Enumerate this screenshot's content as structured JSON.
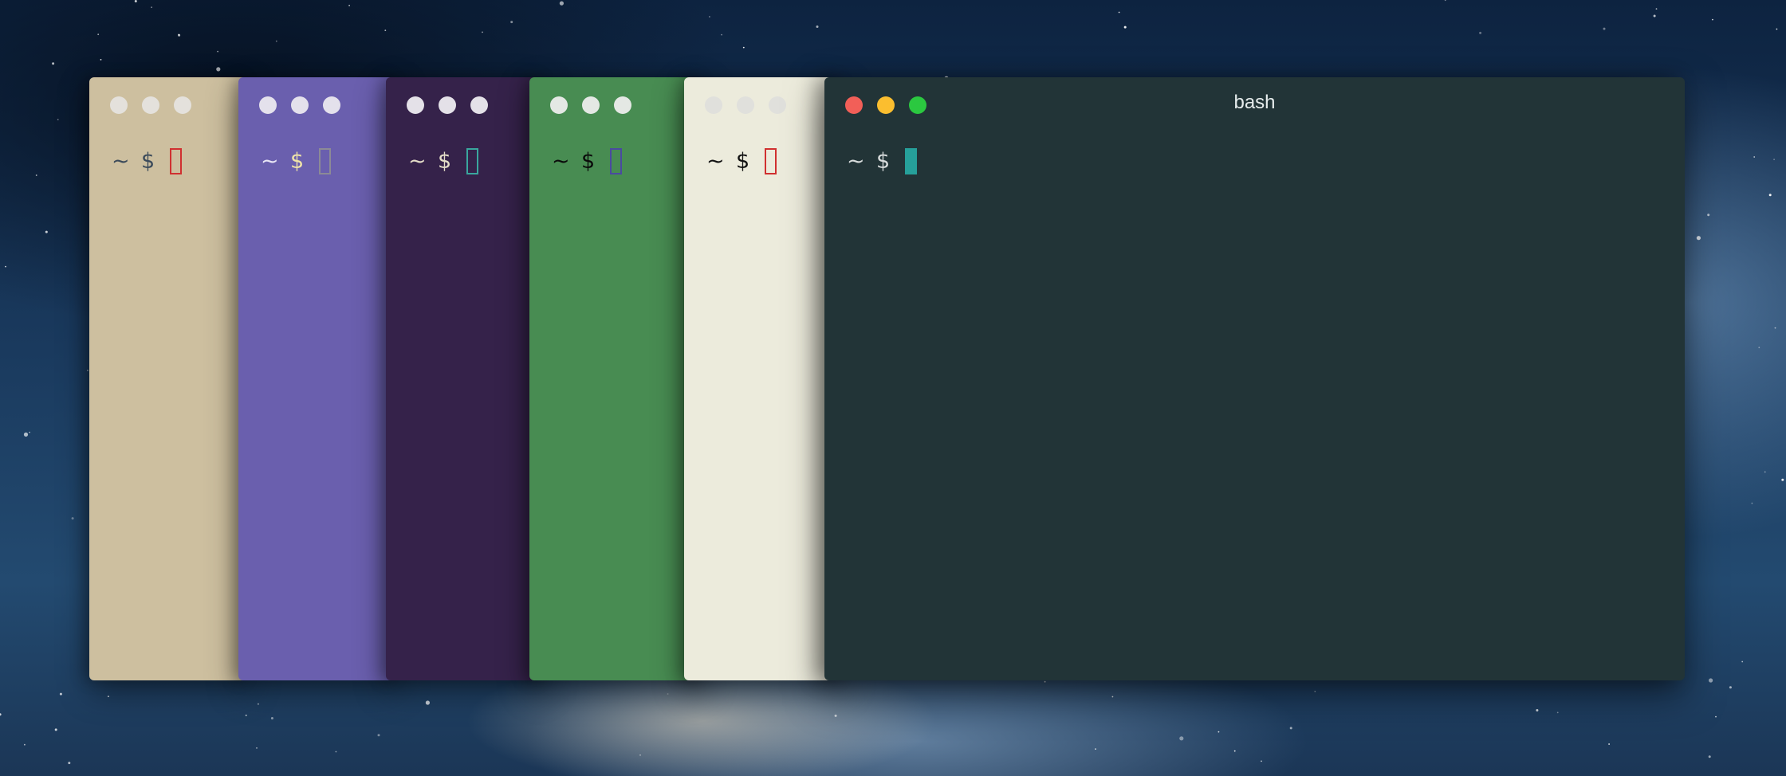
{
  "desktop": {
    "wallpaper": "space-galaxy-wallpaper"
  },
  "windows": [
    {
      "theme_bg": "#cdbf9f",
      "light_color": "#e4e1dc",
      "fg": "#3b4a5a",
      "dollar_color": "#3b4a5a",
      "cursor_color": "#d03030",
      "cursor_style": "outline",
      "prompt": {
        "tilde": "~",
        "dollar": "$"
      }
    },
    {
      "theme_bg": "#6a5fae",
      "light_color": "#e4e1ec",
      "fg": "#e9e6f5",
      "dollar_color": "#f0e4a8",
      "cursor_color": "#8c8a96",
      "cursor_style": "outline",
      "prompt": {
        "tilde": "~",
        "dollar": "$"
      }
    },
    {
      "theme_bg": "#35224a",
      "light_color": "#e4e1e8",
      "fg": "#e4ddc8",
      "dollar_color": "#e4ddc8",
      "cursor_color": "#3aa79e",
      "cursor_style": "outline",
      "prompt": {
        "tilde": "~",
        "dollar": "$"
      }
    },
    {
      "theme_bg": "#488c52",
      "light_color": "#e4e8e4",
      "fg": "#0a0a0a",
      "dollar_color": "#0a0a0a",
      "cursor_color": "#4a4aa0",
      "cursor_style": "outline",
      "prompt": {
        "tilde": "~",
        "dollar": "$"
      }
    },
    {
      "theme_bg": "#ecebdc",
      "light_color": "#e0e0dc",
      "fg": "#111111",
      "dollar_color": "#111111",
      "cursor_color": "#d03030",
      "cursor_style": "outline",
      "prompt": {
        "tilde": "~",
        "dollar": "$"
      }
    },
    {
      "theme_bg": "#223437",
      "title": "bash",
      "fg": "#d8dcdc",
      "dollar_color": "#d8dcdc",
      "cursor_color": "#26a09a",
      "cursor_style": "block",
      "lights": {
        "close": "#f25f58",
        "minimize": "#fbbe2f",
        "zoom": "#2bc840"
      },
      "prompt": {
        "tilde": "~",
        "dollar": "$"
      }
    }
  ]
}
